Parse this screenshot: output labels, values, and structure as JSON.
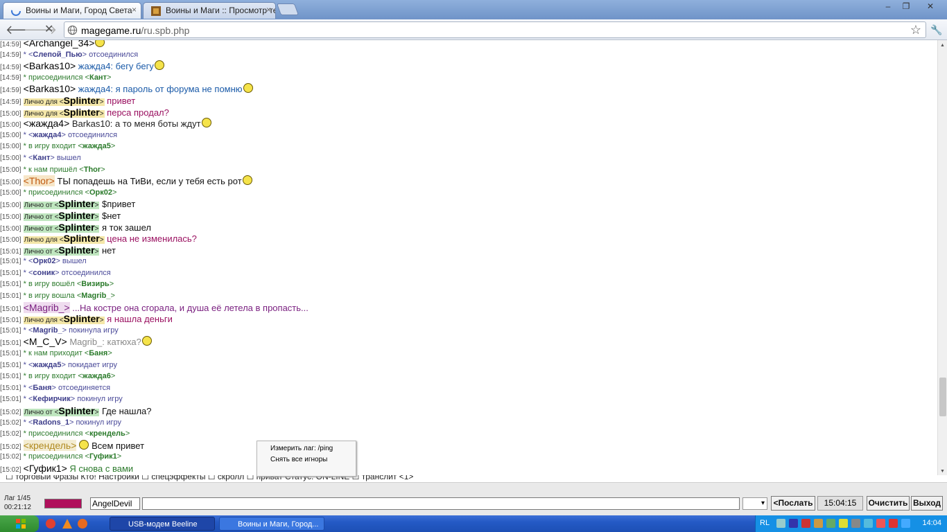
{
  "browser": {
    "tabs": [
      {
        "title": "Воины и Маги, Город Света",
        "active": true
      },
      {
        "title": "Воины и Маги :: Просмотр те",
        "active": false
      }
    ],
    "close_glyph": "×",
    "url_host": "magegame.ru",
    "url_path": "/ru.spb.php",
    "nav": {
      "back": "🡐",
      "forward": "🡒",
      "stop": "✕",
      "star": "☆",
      "wrench": "🔧"
    },
    "window_controls": {
      "minimize": "–",
      "restore": "❐",
      "close": "✕"
    }
  },
  "chat_lines": [
    {
      "time": "[14:59]",
      "kind": "msg",
      "name": "<Archangel_34>",
      "text": "",
      "text_color": "#000000",
      "smiley": true
    },
    {
      "time": "[14:59]",
      "kind": "sysq",
      "pre": "* <",
      "name": "Слепой_Пью",
      "post": "> отсоединился"
    },
    {
      "time": "[14:59]",
      "kind": "msg",
      "name": "<Barkas10>",
      "text": " жажда4: бегу бегу",
      "text_color": "#1a5aa8",
      "smiley": true
    },
    {
      "time": "[14:59]",
      "kind": "sys",
      "pre": "* присоединился <",
      "name": "Кант",
      "post": ">"
    },
    {
      "time": "[14:59]",
      "kind": "msg",
      "name": "<Barkas10>",
      "text": " жажда4: я пароль от форума не помню",
      "text_color": "#1a5aa8",
      "smiley": true
    },
    {
      "time": "[14:59]",
      "kind": "pvt",
      "label": "Лично для <",
      "name": "Splinter",
      "close": ">",
      "text": " привет",
      "text_color": "#9a1060"
    },
    {
      "time": "[15:00]",
      "kind": "pvt",
      "label": "Лично для <",
      "name": "Splinter",
      "close": ">",
      "text": " перса продал?",
      "text_color": "#9a1060"
    },
    {
      "time": "[15:00]",
      "kind": "msg",
      "name": "<жажда4>",
      "text": " Barkas10: а то меня боты ждут",
      "text_color": "#222222",
      "smiley": true
    },
    {
      "time": "[15:00]",
      "kind": "sysq",
      "pre": "* <",
      "name": "жажда4",
      "post": "> отсоединился"
    },
    {
      "time": "[15:00]",
      "kind": "sys",
      "pre": "* в игру входит <",
      "name": "жажда5",
      "post": ">"
    },
    {
      "time": "[15:00]",
      "kind": "sysq",
      "pre": "* <",
      "name": "Кант",
      "post": "> вышел"
    },
    {
      "time": "[15:00]",
      "kind": "sys",
      "pre": "* к нам пришёл <",
      "name": "Thor",
      "post": ">"
    },
    {
      "time": "[15:00]",
      "kind": "msg",
      "name": "<Thor>",
      "name_color": "#c05a10",
      "name_bg": "#f7e6c8",
      "text": " ТЫ попадешь на ТиВи, если у тебя есть рот",
      "text_color": "#111111",
      "smiley": true
    },
    {
      "time": "[15:00]",
      "kind": "sys",
      "pre": "* присоединился <",
      "name": "Орк02",
      "post": ">"
    },
    {
      "time": "[15:00]",
      "kind": "pvf",
      "label": "Лично от <",
      "name": "Splinter",
      "close": ">",
      "text": " $привет",
      "text_color": "#111111"
    },
    {
      "time": "[15:00]",
      "kind": "pvf",
      "label": "Лично от <",
      "name": "Splinter",
      "close": ">",
      "text": " $нет",
      "text_color": "#111111"
    },
    {
      "time": "[15:00]",
      "kind": "pvf",
      "label": "Лично от <",
      "name": "Splinter",
      "close": ">",
      "text": " я ток зашел",
      "text_color": "#111111"
    },
    {
      "time": "[15:00]",
      "kind": "pvt",
      "label": "Лично для <",
      "name": "Splinter",
      "close": ">",
      "text": " цена не изменилась?",
      "text_color": "#9a1060"
    },
    {
      "time": "[15:01]",
      "kind": "pvf",
      "label": "Лично от <",
      "name": "Splinter",
      "close": ">",
      "text": " нет",
      "text_color": "#111111"
    },
    {
      "time": "[15:01]",
      "kind": "sysq",
      "pre": "* <",
      "name": "Орк02",
      "post": "> вышел"
    },
    {
      "time": "[15:01]",
      "kind": "sysq",
      "pre": "* <",
      "name": "соник",
      "post": "> отсоединился"
    },
    {
      "time": "[15:01]",
      "kind": "sys",
      "pre": "* в игру вошёл <",
      "name": "Визирь",
      "post": ">"
    },
    {
      "time": "[15:01]",
      "kind": "sys",
      "pre": "* в игру вошла <",
      "name": "Magrib_",
      "post": ">"
    },
    {
      "time": "[15:01]",
      "kind": "msg",
      "name": "<Magrib_>",
      "name_color": "#7a2080",
      "name_bg": "#efdcef",
      "text": " ...На костре она сгорала, и душа её летела в пропасть...",
      "text_color": "#7a2080",
      "smiley": false
    },
    {
      "time": "[15:01]",
      "kind": "pvt",
      "label": "Лично для <",
      "name": "Splinter",
      "close": ">",
      "text": " я нашла деньги",
      "text_color": "#9a1060"
    },
    {
      "time": "[15:01]",
      "kind": "sysq",
      "pre": "* <",
      "name": "Magrib_",
      "post": "> покинула игру"
    },
    {
      "time": "[15:01]",
      "kind": "msg",
      "name": "<M_C_V>",
      "text": " Magrib_: катюха?",
      "text_color": "#888888",
      "smiley": true
    },
    {
      "time": "[15:01]",
      "kind": "sys",
      "pre": "* к нам приходит <",
      "name": "Баня",
      "post": ">"
    },
    {
      "time": "[15:01]",
      "kind": "sysq",
      "pre": "* <",
      "name": "жажда5",
      "post": "> покидает игру"
    },
    {
      "time": "[15:01]",
      "kind": "sys",
      "pre": "* в игру входит <",
      "name": "жажда6",
      "post": ">"
    },
    {
      "time": "[15:01]",
      "kind": "sysq",
      "pre": "* <",
      "name": "Баня",
      "post": "> отсоединяется"
    },
    {
      "time": "[15:01]",
      "kind": "sysq",
      "pre": "* <",
      "name": "Кефирчик",
      "post": "> покинул игру"
    },
    {
      "time": "[15:02]",
      "kind": "pvf",
      "label": "Лично от <",
      "name": "Splinter",
      "close": ">",
      "text": " Где нашла?",
      "text_color": "#111111"
    },
    {
      "time": "[15:02]",
      "kind": "sysq",
      "pre": "* <",
      "name": "Radons_1",
      "post": "> покинул игру"
    },
    {
      "time": "[15:02]",
      "kind": "sys",
      "pre": "* присоединился <",
      "name": "крендель",
      "post": ">"
    },
    {
      "time": "[15:02]",
      "kind": "msg",
      "name": "<крендель>",
      "name_color": "#b08a20",
      "name_bg": "#f3ecd2",
      "text": " Всем привет",
      "text_color": "#111111",
      "smiley": true,
      "smiley_before": true
    },
    {
      "time": "[15:02]",
      "kind": "sys",
      "pre": "* присоединился <",
      "name": "Гуфик1",
      "post": ">"
    },
    {
      "time": "[15:02]",
      "kind": "msg",
      "name": "<Гуфик1>",
      "text": " Я снова с вами",
      "text_color": "#2c7a2c",
      "smiley": false
    }
  ],
  "popup_menu": [
    "Измерить лаг: /ping",
    "Снять все игноры"
  ],
  "options_row": {
    "text": "☐ торговый  Фразы  Кто!  Настройки  ☐ спецэффекты  ☐ скролл  ☐ приват  Статус: ON-LINE  ☐ транслит <1>"
  },
  "bottom_bar": {
    "lag_label": "Лаг 1/45",
    "timer": "00:21:12",
    "nick": "AngelDevil",
    "color": "#b0105c",
    "send_label": "<Послать",
    "clock": "15:04:15",
    "clear_label": "Очистить",
    "exit_label": "Выход"
  },
  "taskbar": {
    "start_label": "",
    "tasks": [
      {
        "label": "USB-модем Beeline",
        "active": false
      },
      {
        "label": "Воины и Маги, Город...",
        "active": true
      }
    ],
    "lang": "RL",
    "time": "14:04"
  }
}
